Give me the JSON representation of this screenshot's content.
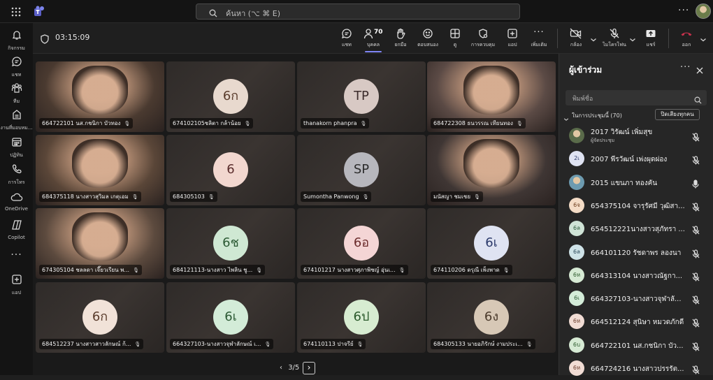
{
  "search": {
    "placeholder": "ค้นหา (⌥ ⌘ E)"
  },
  "rail": [
    {
      "icon": "bell-icon",
      "label": "กิจกรรม"
    },
    {
      "icon": "chat-icon",
      "label": "แชท"
    },
    {
      "icon": "teams-icon",
      "label": "ทีม"
    },
    {
      "icon": "assignments-icon",
      "label": "งานที่มอบหม..."
    },
    {
      "icon": "calendar-icon",
      "label": "ปฏิทิน"
    },
    {
      "icon": "phone-icon",
      "label": "การโทร"
    },
    {
      "icon": "onedrive-icon",
      "label": "OneDrive"
    },
    {
      "icon": "copilot-icon",
      "label": "Copilot"
    },
    {
      "icon": "more-icon",
      "label": ""
    },
    {
      "icon": "add-app-icon",
      "label": "แอป"
    }
  ],
  "meeting": {
    "timer": "03:15:09",
    "people_count": "70"
  },
  "toolbar": {
    "chat": "แชท",
    "people": "บุคคล",
    "raise": "ยกมือ",
    "react": "ตอบสนอง",
    "view": "ดู",
    "controls": "การควบคุม",
    "apps": "แอป",
    "more": "เพิ่มเติม",
    "camera": "กล้อง",
    "mic": "ไมโครโฟน",
    "share": "แชร์",
    "leave": "ออก"
  },
  "tiles": [
    {
      "name": "664722101 นส.กชนิกา บัวทอง",
      "type": "video",
      "tone": "#4a3a30"
    },
    {
      "name": "674102105ชลิตา กล้าน้อย",
      "type": "avatar",
      "initials": "6ก",
      "bg": "#e8d9ce",
      "fg": "#5a3c2c"
    },
    {
      "name": "thanakorn phanpra",
      "type": "avatar",
      "initials": "TP",
      "bg": "#d8c9c4",
      "fg": "#3c2c2c"
    },
    {
      "name": "684722308 ธนวรรณ เทียนทอง",
      "type": "video",
      "tone": "#5b4a45"
    },
    {
      "name": "684375118 นางสาวสุวิมล เกตุเอม",
      "type": "video",
      "tone": "#5a4638"
    },
    {
      "name": "684305103",
      "type": "avatar",
      "initials": "6",
      "bg": "#f2d7cf",
      "fg": "#5a2c2c"
    },
    {
      "name": "Sumontha Panwong",
      "type": "avatar",
      "initials": "SP",
      "bg": "#b7b7bd",
      "fg": "#2c2c2c"
    },
    {
      "name": "มนัสญา ชมเชย",
      "type": "video",
      "tone": "#3f3634"
    },
    {
      "name": "674305104 ชลลดา เจี๊ยวเรียน พ...",
      "type": "video",
      "tone": "#5c4a3e"
    },
    {
      "name": "684121113-นางสาว ไพลิน ชู...",
      "type": "avatar",
      "initials": "6ช",
      "bg": "#cfe8d3",
      "fg": "#2c5a34"
    },
    {
      "name": "674101217 นางสาวศุภาพิชญ์ อุ่นเ...",
      "type": "avatar",
      "initials": "6อ",
      "bg": "#f4d5d5",
      "fg": "#6b2c2c"
    },
    {
      "name": "674110206 ดรุณี เพ็งพาด",
      "type": "avatar",
      "initials": "6เ",
      "bg": "#dfe3f2",
      "fg": "#2c3a6b"
    },
    {
      "name": "684512237 นางสาวสาวลักษณ์ ก้...",
      "type": "avatar",
      "initials": "6ก",
      "bg": "#f1e2d8",
      "fg": "#5a3c2c"
    },
    {
      "name": "664327103-นางสาวจุฬาลักษณ์ เ...",
      "type": "avatar",
      "initials": "6เ",
      "bg": "#d3ecd8",
      "fg": "#2c5a34"
    },
    {
      "name": "674110113 ปาจรีย์",
      "type": "avatar",
      "initials": "6ป",
      "bg": "#d7ecd1",
      "fg": "#2c5a2c"
    },
    {
      "name": "684305133 นายอภิรักษ์ งามประเ...",
      "type": "avatar",
      "initials": "6ง",
      "bg": "#d7c8b6",
      "fg": "#4a3a2c"
    }
  ],
  "pager": {
    "text": "3/5"
  },
  "panel": {
    "title": "ผู้เข้าร่วม",
    "search_placeholder": "พิมพ์ชื่อ",
    "section": "ในการประชุมนี้ (70)",
    "mute_all": "ปิดเสียงทุกคน",
    "participants": [
      {
        "name": "2017 วิรัฒน์ เพิ่มสุข",
        "role": "ผู้จัดประชุม",
        "initials": "",
        "photo": true,
        "bg": "#5a6b4a",
        "mic": "muted"
      },
      {
        "name": "2007 พีรวัฒน์ เพ่งผุดผ่อง",
        "role": "",
        "initials": "2เ",
        "bg": "#dfe3f2",
        "fg": "#2c3a6b",
        "mic": "muted"
      },
      {
        "name": "2015 แขนภา ทองคัน",
        "role": "",
        "initials": "",
        "photo": true,
        "bg": "#6d9bb0",
        "mic": "on"
      },
      {
        "name": "654375104 จารุรัศมี วุฒิสา...",
        "role": "",
        "initials": "6จ",
        "bg": "#f4dcc6",
        "fg": "#6b3c1c",
        "mic": "muted"
      },
      {
        "name": "654512221นางสาวสุภัทรา ...",
        "role": "",
        "initials": "6ล",
        "bg": "#cfe3d6",
        "fg": "#2c5a3c",
        "mic": "muted"
      },
      {
        "name": "664101120 รัชดาพร ลองนา",
        "role": "",
        "initials": "6ล",
        "bg": "#cfe3e8",
        "fg": "#2c4a5a",
        "mic": "muted"
      },
      {
        "name": "664313104 นางสาวณัฐกา...",
        "role": "",
        "initials": "6ห",
        "bg": "#d6ead4",
        "fg": "#2c5a2c",
        "mic": "muted"
      },
      {
        "name": "664327103-นางสาวจุฬาลั...",
        "role": "",
        "initials": "6เ",
        "bg": "#d3ecd8",
        "fg": "#2c5a34",
        "mic": "muted"
      },
      {
        "name": "664512124 สุนิษา หมวดภักดี",
        "role": "",
        "initials": "6ห",
        "bg": "#f1dcd4",
        "fg": "#6b3c2c",
        "mic": "muted"
      },
      {
        "name": "664722101 นส.กชนิกา บัว...",
        "role": "",
        "initials": "6บ",
        "bg": "#d6ead4",
        "fg": "#2c5a2c",
        "mic": "muted"
      },
      {
        "name": "664724216 นางสาวปรรรัต...",
        "role": "",
        "initials": "6ห",
        "bg": "#f1dcd4",
        "fg": "#6b3c2c",
        "mic": "muted"
      }
    ]
  },
  "colors": {
    "accent": "#7f85f5",
    "leave": "#c4314b"
  }
}
